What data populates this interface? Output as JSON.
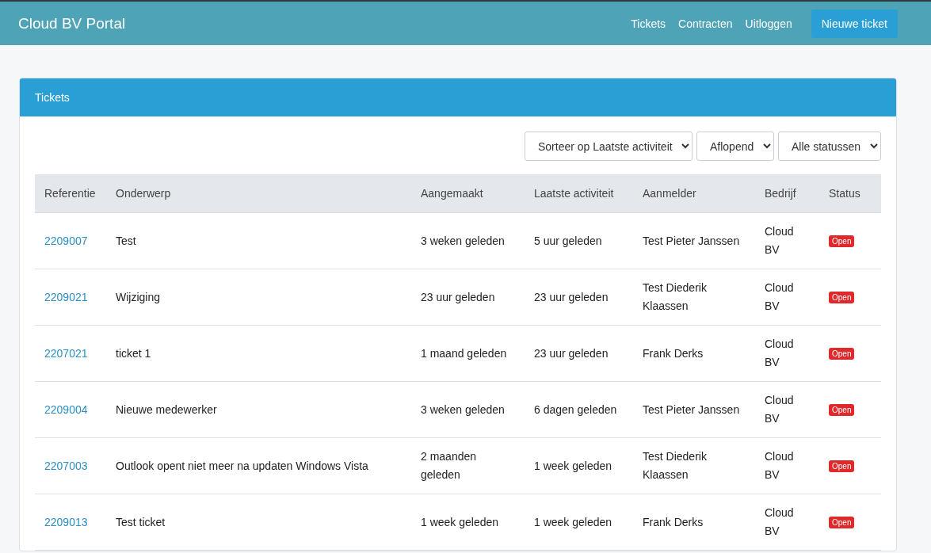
{
  "navbar": {
    "brand": "Cloud BV Portal",
    "links": [
      "Tickets",
      "Contracten",
      "Uitloggen"
    ],
    "button": "Nieuwe ticket"
  },
  "card": {
    "title": "Tickets",
    "filters": [
      {
        "value": "Sorteer op Laatste activiteit"
      },
      {
        "value": "Aflopend"
      },
      {
        "value": "Alle statussen"
      }
    ],
    "table": {
      "columns": [
        "Referentie",
        "Onderwerp",
        "Aangemaakt",
        "Laatste activiteit",
        "Aanmelder",
        "Bedrijf",
        "Status"
      ],
      "rows": [
        {
          "reference": "2209007",
          "subject": "Test",
          "created": "3 weken geleden",
          "last_activity": "5 uur geleden",
          "reporter": "Test Pieter Janssen",
          "company": "Cloud BV",
          "status": "Open"
        },
        {
          "reference": "2209021",
          "subject": "Wijziging",
          "created": "23 uur geleden",
          "last_activity": "23 uur geleden",
          "reporter": "Test Diederik Klaassen",
          "company": "Cloud BV",
          "status": "Open"
        },
        {
          "reference": "2207021",
          "subject": "ticket 1",
          "created": "1 maand geleden",
          "last_activity": "23 uur geleden",
          "reporter": "Frank Derks",
          "company": "Cloud BV",
          "status": "Open"
        },
        {
          "reference": "2209004",
          "subject": "Nieuwe medewerker",
          "created": "3 weken geleden",
          "last_activity": "6 dagen geleden",
          "reporter": "Test Pieter Janssen",
          "company": "Cloud BV",
          "status": "Open"
        },
        {
          "reference": "2207003",
          "subject": "Outlook opent niet meer na updaten Windows Vista",
          "created": "2 maanden geleden",
          "last_activity": "1 week geleden",
          "reporter": "Test Diederik Klaassen",
          "company": "Cloud BV",
          "status": "Open"
        },
        {
          "reference": "2209013",
          "subject": "Test ticket",
          "created": "1 week geleden",
          "last_activity": "1 week geleden",
          "reporter": "Frank Derks",
          "company": "Cloud BV",
          "status": "Open"
        }
      ]
    }
  }
}
